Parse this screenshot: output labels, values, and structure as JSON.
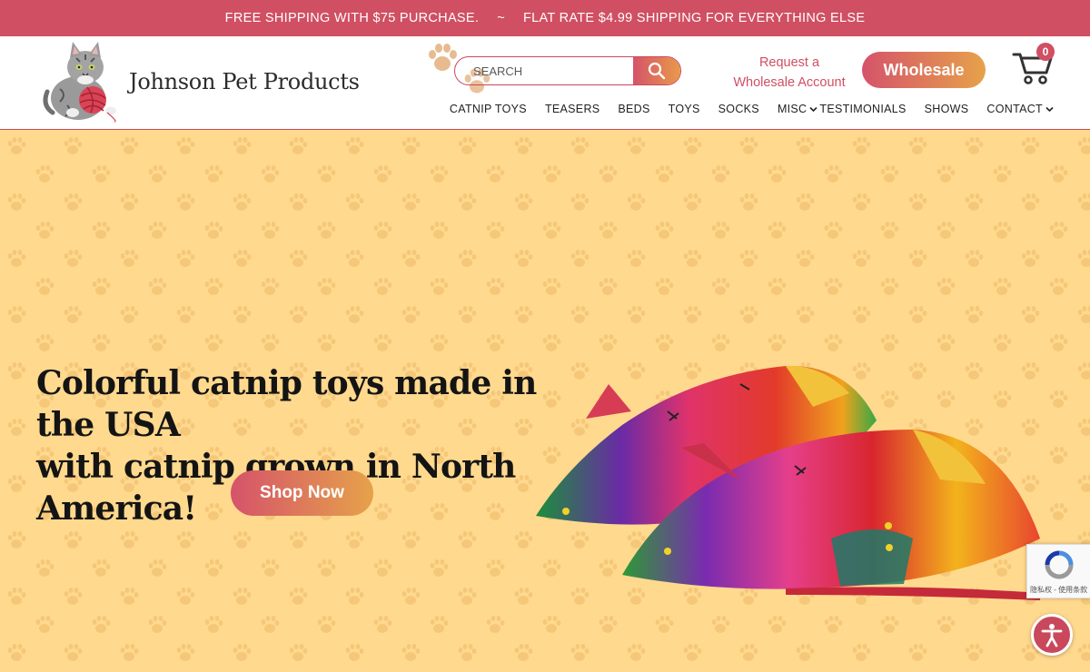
{
  "announcement": {
    "left": "FREE SHIPPING WITH $75 PURCHASE.",
    "separator": "~",
    "right": "FLAT RATE $4.99 SHIPPING FOR EVERYTHING ELSE"
  },
  "header": {
    "brand": "Johnson Pet Products",
    "search_placeholder": "SEARCH",
    "request_line1": "Request a",
    "request_line2": "Wholesale Account",
    "wholesale_label": "Wholesale",
    "cart_count": "0"
  },
  "nav": [
    {
      "label": "CATNIP TOYS"
    },
    {
      "label": "TEASERS"
    },
    {
      "label": "BEDS"
    },
    {
      "label": "TOYS"
    },
    {
      "label": "SOCKS"
    },
    {
      "label": "MISC"
    },
    {
      "label": "TESTIMONIALS"
    },
    {
      "label": "SHOWS"
    },
    {
      "label": "CONTACT"
    }
  ],
  "hero": {
    "headline_line1": "Colorful catnip toys made in the USA",
    "headline_line2": "with catnip grown in North America!",
    "cta": "Shop Now"
  },
  "recaptcha": {
    "text": "隐私权 - 使用条款"
  },
  "colors": {
    "brand_red": "#d04f62",
    "gradient_end": "#e6a24a",
    "hero_bg": "#ffd98e",
    "paw": "#f5c877"
  },
  "icons": [
    "cat-logo",
    "search-icon",
    "cart-icon",
    "chevron-down-icon",
    "paw-icon",
    "recaptcha-icon",
    "accessibility-icon"
  ]
}
